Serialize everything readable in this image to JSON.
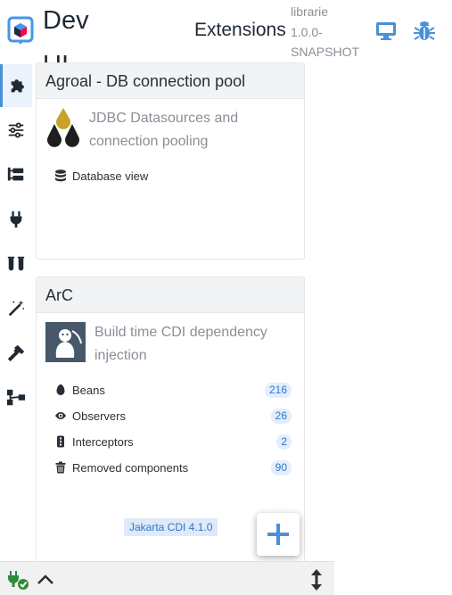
{
  "header": {
    "app_title": "Dev UI",
    "page_heading": "Extensions",
    "version": "librarie 1.0.0-SNAPSHOT"
  },
  "nav": {
    "items": [
      {
        "icon": "puzzle-icon",
        "active": true
      },
      {
        "icon": "sliders-icon",
        "active": false
      },
      {
        "icon": "folder-tree-icon",
        "active": false
      },
      {
        "icon": "plug-icon",
        "active": false
      },
      {
        "icon": "flask-icon",
        "active": false
      },
      {
        "icon": "magic-wand-icon",
        "active": false
      },
      {
        "icon": "hammer-icon",
        "active": false
      },
      {
        "icon": "diagram-icon",
        "active": false
      }
    ]
  },
  "cards": [
    {
      "title": "Agroal - DB connection pool",
      "description": "JDBC Datasources and connection pooling",
      "logo": "agroal-drops-logo",
      "links": [
        {
          "icon": "database-icon",
          "label": "Database view"
        }
      ]
    },
    {
      "title": "ArC",
      "description": "Build time CDI dependency injection",
      "logo": "arc-logo",
      "links": [
        {
          "icon": "egg-icon",
          "label": "Beans",
          "count": "216"
        },
        {
          "icon": "eye-icon",
          "label": "Observers",
          "count": "26"
        },
        {
          "icon": "ellipsis-vertical-icon",
          "label": "Interceptors",
          "count": "2"
        },
        {
          "icon": "trash-icon",
          "label": "Removed components",
          "count": "90"
        }
      ],
      "spec_badge": "Jakarta CDI 4.1.0"
    }
  ],
  "colors": {
    "accent": "#4a90d9",
    "badge_text": "#2a78c9",
    "footer_plug": "#2e8b3a"
  }
}
